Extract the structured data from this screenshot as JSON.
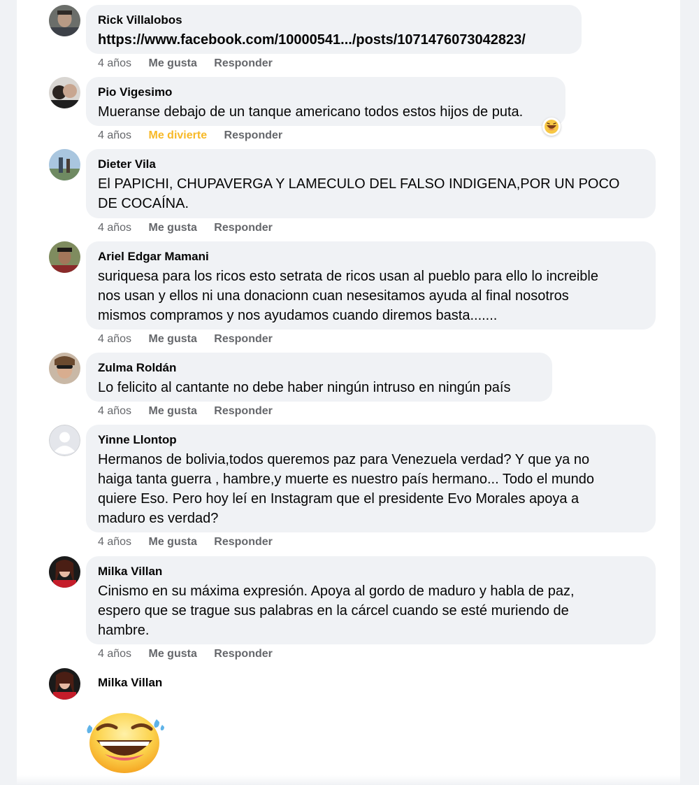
{
  "comments": [
    {
      "author": "Rick Villalobos",
      "text": "https://www.facebook.com/10000541.../posts/1071476073042823/",
      "time": "4 años",
      "like": "Me gusta",
      "reply": "Responder"
    },
    {
      "author": "Pio Vigesimo",
      "text": "Mueranse debajo de un tanque americano todos estos hijos de puta.",
      "time": "4 años",
      "like": "Me divierte",
      "reply": "Responder",
      "reaction": "haha-icon"
    },
    {
      "author": "Dieter Vila",
      "lines": [
        "El PAPICHI, CHUPAVERGA Y LAMECULO DEL FALSO INDIGENA,POR UN POCO",
        "DE COCAÍNA."
      ],
      "time": "4 años",
      "like": "Me gusta",
      "reply": "Responder"
    },
    {
      "author": "Ariel Edgar Mamani",
      "lines": [
        "suriquesa para los ricos esto setrata de ricos usan al pueblo para ello lo increible",
        "nos usan y ellos ni una donacionn cuan nesesitamos ayuda al final nosotros",
        "mismos compramos y nos ayudamos cuando diremos basta......."
      ],
      "time": "4 años",
      "like": "Me gusta",
      "reply": "Responder"
    },
    {
      "author": "Zulma Roldán",
      "text": "Lo felicito al cantante no debe haber ningún intruso en ningún país",
      "time": "4 años",
      "like": "Me gusta",
      "reply": "Responder"
    },
    {
      "author": "Yinne Llontop",
      "lines": [
        "Hermanos de bolivia,todos queremos paz para Venezuela verdad? Y que ya no",
        "haiga tanta guerra , hambre,y muerte es nuestro país hermano... Todo el mundo",
        "quiere Eso. Pero hoy leí en Instagram que el presidente Evo Morales apoya a",
        "maduro es verdad?"
      ],
      "time": "4 años",
      "like": "Me gusta",
      "reply": "Responder"
    },
    {
      "author": "Milka Villan",
      "lines": [
        "Cinismo en su máxima expresión. Apoya al gordo de maduro y habla de paz,",
        "espero que se trague sus palabras en la cárcel cuando se esté muriendo de",
        "hambre."
      ],
      "time": "4 años",
      "like": "Me gusta",
      "reply": "Responder"
    },
    {
      "author": "Milka Villan",
      "sticker": "laughing-tears-icon"
    }
  ],
  "colors": {
    "page_bg": "#f0f2f5",
    "bubble_bg": "#f0f2f5",
    "meta_text": "#65676b",
    "haha_label": "#f7b928"
  }
}
